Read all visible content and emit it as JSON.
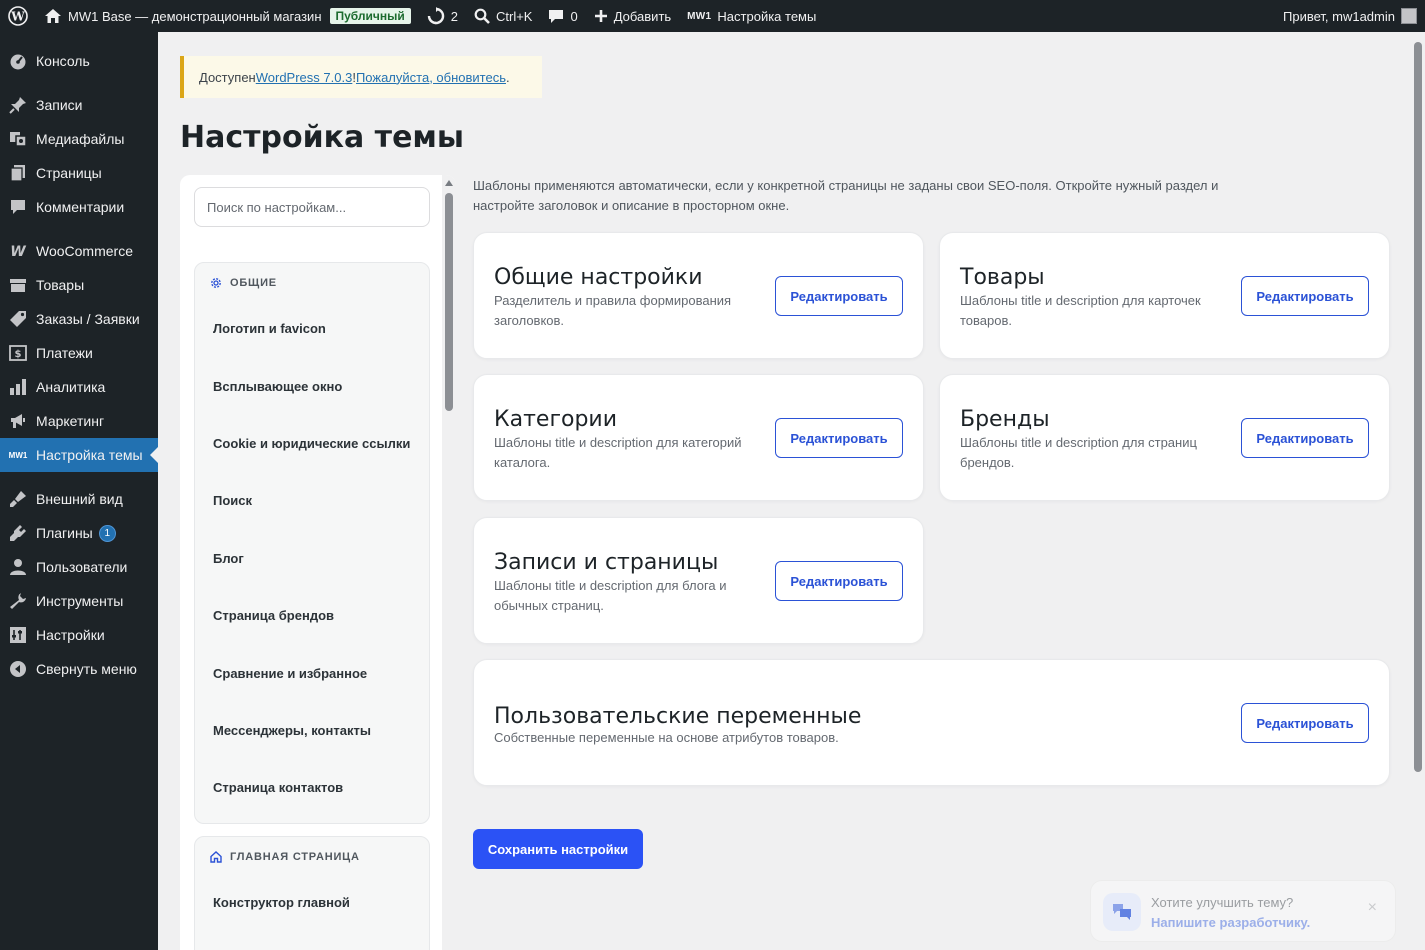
{
  "adminbar": {
    "site_name": "MW1 Base — демонстрационный магазин",
    "public_badge": "Публичный",
    "updates_count": "2",
    "search_shortcut": "Ctrl+K",
    "comments_count": "0",
    "add_new": "Добавить",
    "mw1_label": "MW1",
    "theme_settings": "Настройка темы",
    "greeting": "Привет, mw1admin"
  },
  "sidebar": {
    "items": [
      {
        "label": "Консоль",
        "icon": "dashboard-icon"
      },
      {
        "label": "Записи",
        "icon": "pin-icon"
      },
      {
        "label": "Медиафайлы",
        "icon": "media-icon"
      },
      {
        "label": "Страницы",
        "icon": "pages-icon"
      },
      {
        "label": "Комментарии",
        "icon": "comments-icon"
      },
      {
        "label": "WooCommerce",
        "icon": "woocommerce-icon"
      },
      {
        "label": "Товары",
        "icon": "products-icon"
      },
      {
        "label": "Заказы / Заявки",
        "icon": "orders-icon"
      },
      {
        "label": "Платежи",
        "icon": "payments-icon"
      },
      {
        "label": "Аналитика",
        "icon": "analytics-icon"
      },
      {
        "label": "Маркетинг",
        "icon": "marketing-icon"
      },
      {
        "label": "Настройка темы",
        "icon": "mw1-icon",
        "active": true
      },
      {
        "label": "Внешний вид",
        "icon": "appearance-icon"
      },
      {
        "label": "Плагины",
        "icon": "plugins-icon",
        "badge": "1"
      },
      {
        "label": "Пользователи",
        "icon": "users-icon"
      },
      {
        "label": "Инструменты",
        "icon": "tools-icon"
      },
      {
        "label": "Настройки",
        "icon": "settings-icon"
      },
      {
        "label": "Свернуть меню",
        "icon": "collapse-icon"
      }
    ]
  },
  "notice": {
    "prefix": "Доступен ",
    "version_link": "WordPress 7.0.3",
    "separator": "! ",
    "update_link": "Пожалуйста, обновитесь",
    "suffix": "."
  },
  "page": {
    "title": "Настройка темы"
  },
  "nav": {
    "search_placeholder": "Поиск по настройкам...",
    "groups": [
      {
        "title": "ОБЩИЕ",
        "links": [
          "Логотип и favicon",
          "Всплывающее окно",
          "Cookie и юридические ссылки",
          "Поиск",
          "Блог",
          "Страница брендов",
          "Сравнение и избранное",
          "Мессенджеры, контакты",
          "Страница контактов"
        ]
      },
      {
        "title": "ГЛАВНАЯ СТРАНИЦА",
        "links": [
          "Конструктор главной"
        ]
      }
    ]
  },
  "main": {
    "intro": "Шаблоны применяются автоматически, если у конкретной страницы не заданы свои SEO-поля. Откройте нужный раздел и настройте заголовок и описание в просторном окне.",
    "edit_label": "Редактировать",
    "cards": [
      {
        "title": "Общие настройки",
        "desc": "Разделитель и правила формирования заголовков."
      },
      {
        "title": "Товары",
        "desc": "Шаблоны title и description для карточек товаров."
      },
      {
        "title": "Категории",
        "desc": "Шаблоны title и description для категорий каталога."
      },
      {
        "title": "Бренды",
        "desc": "Шаблоны title и description для страниц брендов."
      },
      {
        "title": "Записи и страницы",
        "desc": "Шаблоны title и description для блога и обычных страниц."
      },
      {
        "title": "Пользовательские переменные",
        "desc": "Собственные переменные на основе атрибутов товаров."
      }
    ],
    "save_label": "Сохранить настройки"
  },
  "toast": {
    "question": "Хотите улучшить тему?",
    "link": "Напишите разработчику.",
    "close": "×"
  }
}
